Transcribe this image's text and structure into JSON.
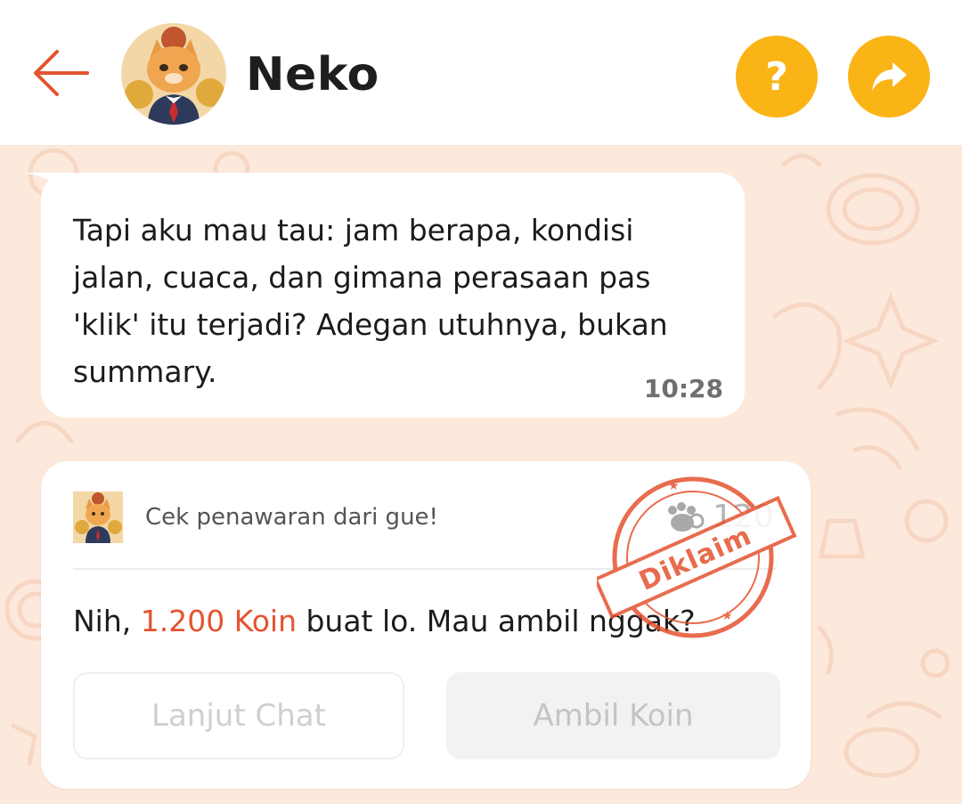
{
  "header": {
    "title": "Neko",
    "help_label": "?",
    "icons": {
      "back": "arrow-left-icon",
      "help": "question-icon",
      "share": "share-arrow-icon"
    },
    "colors": {
      "back": "#e5532f",
      "action_buttons": "#fbb416"
    }
  },
  "messages": [
    {
      "text": "Tapi aku mau tau: jam berapa, kondisi jalan, cuaca, dan gimana perasaan pas 'klik' itu terjadi? Adegan utuhnya, bukan summary.",
      "time": "10:28"
    }
  ],
  "offer_card": {
    "header_text": "Cek penawaran dari gue!",
    "cost": "120",
    "cost_icon": "paw-icon",
    "message_prefix": "Nih, ",
    "message_highlight": "1.200 Koin",
    "message_suffix": " buat lo. Mau ambil nggak?",
    "stamp_text": "Diklaim",
    "secondary_button": "Lanjut Chat",
    "primary_button": "Ambil Koin",
    "colors": {
      "highlight": "#e5532f",
      "stamp": "#e5532f"
    }
  },
  "theme": {
    "chat_background": "#fde9dc"
  }
}
